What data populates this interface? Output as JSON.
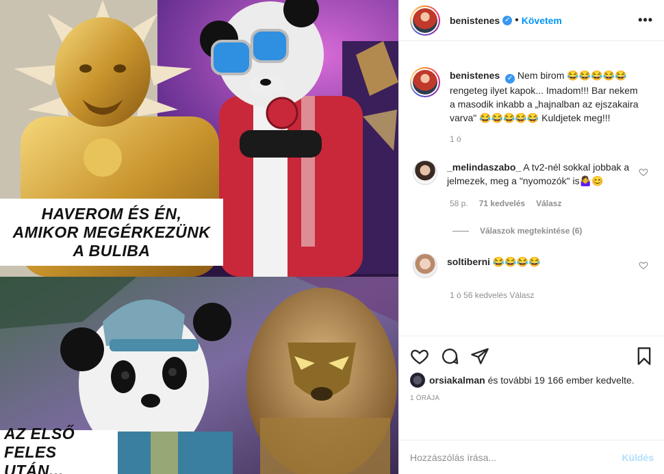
{
  "post": {
    "author": "benistenes",
    "follow_label": "Követem",
    "more_label": "•••",
    "dot": "•"
  },
  "media": {
    "caption_top": [
      "HAVEROM ÉS ÉN,",
      "AMIKOR MEGÉRKEZÜNK",
      "A BULIBA"
    ],
    "caption_bottom": [
      "AZ ELSŐ",
      "FELES UTÁN..."
    ]
  },
  "caption": {
    "author": "benistenes",
    "text": "Nem birom 😂😂😂😂😂 rengeteg ilyet kapok... Imadom!!! Bar nekem a masodik inkabb a „hajnalban az ejszakaira varva\" 😂😂😂😂😂 Kuldjetek meg!!!",
    "time": "1 ó"
  },
  "comments": [
    {
      "author": "_melindaszabo_",
      "text": "A tv2-nél sokkal jobbak a jelmezek, meg a \"nyomozók\" is🤷‍♀️😊",
      "time": "58 p.",
      "likes": "71 kedvelés",
      "reply_label": "Válasz",
      "view_replies": "Válaszok megtekintése (6)"
    },
    {
      "author": "soltiberni",
      "text": "😂😂😂😂",
      "meta_partial": "1 ó    56 kedvelés    Válasz"
    }
  ],
  "actions": {
    "liked_by_user": "orsiakalman",
    "likes_text": " és további 19 166 ember kedvelte.",
    "timestamp": "1 ÓRÁJA"
  },
  "add_comment": {
    "placeholder": "Hozzászólás írása...",
    "send_label": "Küldés"
  },
  "colors": {
    "accent": "#0095f6",
    "send_disabled": "#b2dffc",
    "muted": "#8e8e8e",
    "verified": "#3897f0"
  }
}
